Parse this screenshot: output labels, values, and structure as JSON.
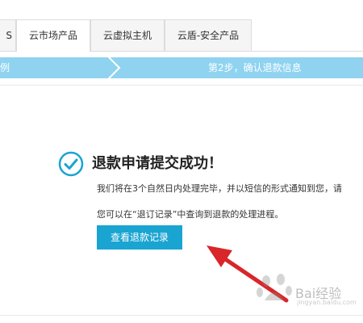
{
  "tabs": [
    {
      "label": "S"
    },
    {
      "label": "云市场产品",
      "active": true
    },
    {
      "label": "云虚拟主机"
    },
    {
      "label": "云盾-安全产品"
    }
  ],
  "steps": {
    "step1": "例",
    "step2": "第2步，确认退款信息",
    "color": "#8fd3f0"
  },
  "success": {
    "icon": "check-circle-icon",
    "title": "退款申请提交成功！",
    "desc1": "我们将在3个自然日内处理完毕，并以短信的形式通知到您，请",
    "desc2": "您可以在“退订记录”中查询到退款的处理进程。",
    "button": "查看退款记录",
    "accent": "#1aa4d1"
  },
  "annotation": {
    "icon": "red-arrow-icon",
    "color": "#d9262a"
  },
  "watermark": {
    "brand": "Bai",
    "text": "经验",
    "sub": "jingyan.baidu.com"
  }
}
